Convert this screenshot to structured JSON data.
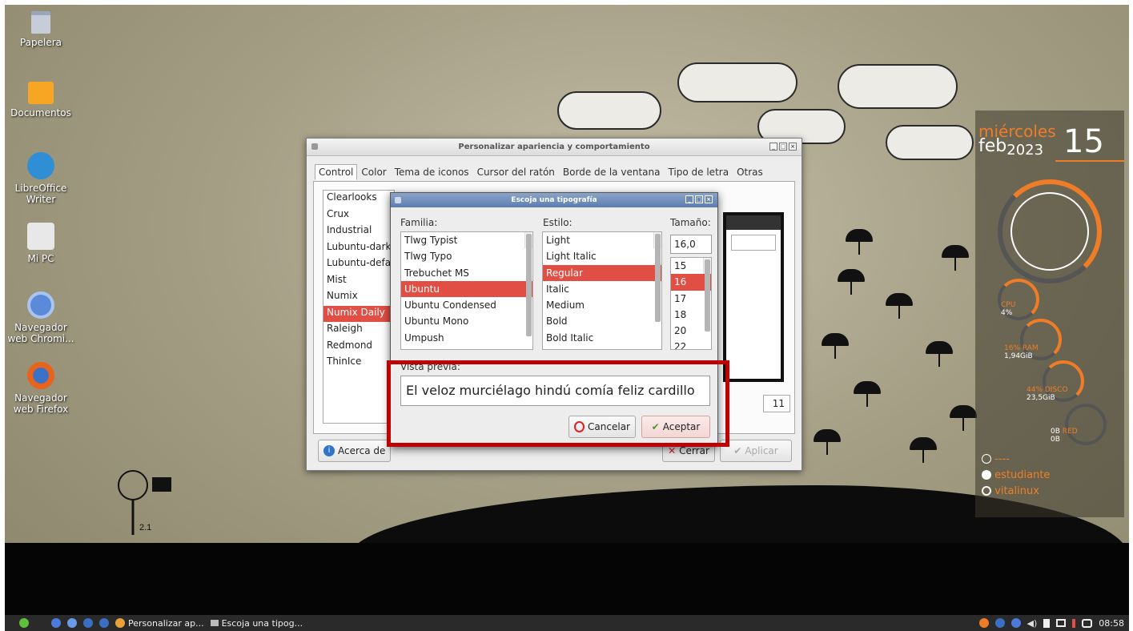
{
  "desktop": {
    "icons": [
      {
        "label": "Papelera",
        "icon": "trash-icon"
      },
      {
        "label": "Documentos",
        "icon": "folder-icon"
      },
      {
        "label": "LibreOffice Writer",
        "icon": "libreoffice-writer-icon"
      },
      {
        "label": "Mi PC",
        "icon": "computer-icon"
      },
      {
        "label": "Navegador web Chromi...",
        "icon": "chromium-icon"
      },
      {
        "label": "Navegador web Firefox",
        "icon": "firefox-icon"
      }
    ],
    "wallpaper_tag": "2.1"
  },
  "conky": {
    "day": "miércoles",
    "month": "feb",
    "year": "2023",
    "daynum": "15",
    "cpu_label": "CPU",
    "cpu_value": "4%",
    "ram_label": "16% RAM",
    "ram_value": "1,94GiB",
    "disk_label": "44% DISCO",
    "disk_value": "23,5GiB",
    "net_label": "RED",
    "net_up": "0B",
    "net_down": "0B",
    "ip": "----",
    "user": "estudiante",
    "host": "vitalinux",
    "accent": "#ef7d28"
  },
  "main_window": {
    "title": "Personalizar apariencia y comportamiento",
    "tabs": [
      "Control",
      "Color",
      "Tema de iconos",
      "Cursor del ratón",
      "Borde de la ventana",
      "Tipo de letra",
      "Otras"
    ],
    "active_tab": 0,
    "themes": [
      "Clearlooks",
      "Crux",
      "Industrial",
      "Lubuntu-dark-",
      "Lubuntu-defa",
      "Mist",
      "Numix",
      "Numix Daily",
      "Raleigh",
      "Redmond",
      "ThinIce"
    ],
    "selected_theme": "Numix Daily",
    "about_label": "Acerca de",
    "close_label": "Cerrar",
    "apply_label": "Aplicar",
    "spin_value": "11"
  },
  "font_dialog": {
    "title": "Escoja una tipografía",
    "family_label": "Familia:",
    "style_label": "Estilo:",
    "size_label": "Tamaño:",
    "families": [
      "Tlwg Typist",
      "Tlwg Typo",
      "Trebuchet MS",
      "Ubuntu",
      "Ubuntu Condensed",
      "Ubuntu Mono",
      "Umpush"
    ],
    "selected_family": "Ubuntu",
    "styles": [
      "Light",
      "Light Italic",
      "Regular",
      "Italic",
      "Medium",
      "Bold",
      "Bold Italic"
    ],
    "selected_style": "Regular",
    "size_value": "16,0",
    "sizes": [
      "15",
      "16",
      "17",
      "18",
      "20",
      "22"
    ],
    "selected_size": "16",
    "preview_label": "Vista previa:",
    "preview_text": "El veloz murciélago hindú comía feliz cardillo",
    "cancel_label": "Cancelar",
    "accept_label": "Aceptar"
  },
  "taskbar": {
    "tasks": [
      "Personalizar ap...",
      "Escoja una tipog..."
    ],
    "clock": "08:58"
  }
}
